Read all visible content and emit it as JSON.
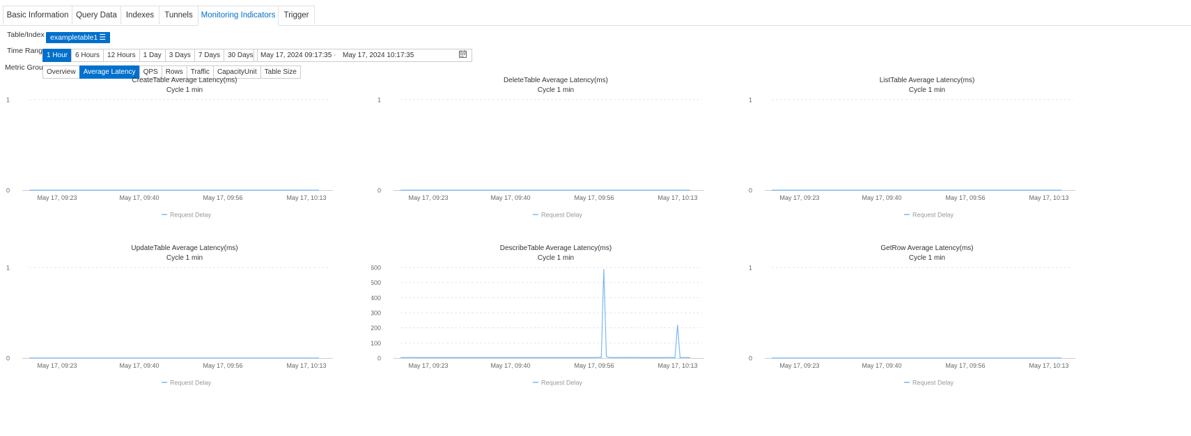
{
  "tabs": [
    "Basic Information",
    "Query Data",
    "Indexes",
    "Tunnels",
    "Monitoring Indicators",
    "Trigger"
  ],
  "active_tab": "Monitoring Indicators",
  "filters": {
    "table_label": "Table/Index",
    "table_value": "exampletable1",
    "time_label": "Time Range",
    "time_options": [
      "1 Hour",
      "6 Hours",
      "12 Hours",
      "1 Day",
      "3 Days",
      "7 Days",
      "30 Days"
    ],
    "time_selected": "1 Hour",
    "start": "May 17, 2024 09:17:35",
    "range_sep": "-",
    "end": "May 17, 2024 10:17:35",
    "metric_label": "Metric Group",
    "metric_options": [
      "Overview",
      "Average Latency",
      "QPS",
      "Rows",
      "Traffic",
      "CapacityUnit",
      "Table Size"
    ],
    "metric_selected": "Average Latency"
  },
  "colors": {
    "accent": "#0070cc",
    "series": "#7ab8f5"
  },
  "chart_data": [
    {
      "type": "line",
      "title": "CreateTable Average Latency(ms)",
      "subtitle": "Cycle 1 min",
      "x_ticks": [
        "May 17, 09:23",
        "May 17, 09:40",
        "May 17, 09:56",
        "May 17, 10:13"
      ],
      "y_ticks": [
        0,
        1
      ],
      "ylim": [
        0,
        1
      ],
      "series": [
        {
          "name": "Request Delay",
          "values": [
            0,
            0
          ]
        }
      ]
    },
    {
      "type": "line",
      "title": "DeleteTable Average Latency(ms)",
      "subtitle": "Cycle 1 min",
      "x_ticks": [
        "May 17, 09:23",
        "May 17, 09:40",
        "May 17, 09:56",
        "May 17, 10:13"
      ],
      "y_ticks": [
        0,
        1
      ],
      "ylim": [
        0,
        1
      ],
      "series": [
        {
          "name": "Request Delay",
          "values": [
            0,
            0
          ]
        }
      ]
    },
    {
      "type": "line",
      "title": "ListTable Average Latency(ms)",
      "subtitle": "Cycle 1 min",
      "x_ticks": [
        "May 17, 09:23",
        "May 17, 09:40",
        "May 17, 09:56",
        "May 17, 10:13"
      ],
      "y_ticks": [
        0,
        1
      ],
      "ylim": [
        0,
        1
      ],
      "series": [
        {
          "name": "Request Delay",
          "values": [
            0,
            0
          ]
        }
      ]
    },
    {
      "type": "line",
      "title": "UpdateTable Average Latency(ms)",
      "subtitle": "Cycle 1 min",
      "x_ticks": [
        "May 17, 09:23",
        "May 17, 09:40",
        "May 17, 09:56",
        "May 17, 10:13"
      ],
      "y_ticks": [
        0,
        1
      ],
      "ylim": [
        0,
        1
      ],
      "series": [
        {
          "name": "Request Delay",
          "values": [
            0,
            0
          ]
        }
      ]
    },
    {
      "type": "line",
      "title": "DescribeTable Average Latency(ms)",
      "subtitle": "Cycle 1 min",
      "x_ticks": [
        "May 17, 09:23",
        "May 17, 09:40",
        "May 17, 09:56",
        "May 17, 10:13"
      ],
      "y_ticks": [
        0,
        100,
        200,
        300,
        400,
        500,
        600
      ],
      "ylim": [
        0,
        600
      ],
      "series": [
        {
          "name": "Request Delay",
          "values": [
            3,
            3,
            3,
            3,
            4,
            3,
            3,
            3,
            3,
            3,
            3,
            3,
            3,
            3,
            3,
            3,
            3,
            3,
            3,
            3,
            3,
            3,
            3,
            3,
            3,
            3,
            3,
            3,
            3,
            3,
            3,
            3,
            3,
            3,
            3,
            3,
            3,
            3,
            3,
            3,
            3,
            3,
            3,
            3,
            3,
            3,
            3,
            3,
            3,
            3,
            3,
            3,
            3,
            3,
            3,
            3,
            3,
            3,
            3,
            3,
            3,
            3,
            3,
            3,
            3,
            3,
            3,
            3,
            3,
            3,
            3,
            3,
            3,
            3,
            3,
            3,
            3,
            3,
            4,
            4,
            590,
            10,
            4,
            3,
            3,
            3,
            3,
            3,
            4,
            3,
            4,
            3,
            3,
            4,
            3,
            3,
            3,
            3,
            3,
            3,
            3,
            3,
            3,
            3,
            3,
            4,
            3,
            3,
            3,
            220,
            3,
            3,
            3,
            3,
            3
          ]
        }
      ]
    },
    {
      "type": "line",
      "title": "GetRow Average Latency(ms)",
      "subtitle": "Cycle 1 min",
      "x_ticks": [
        "May 17, 09:23",
        "May 17, 09:40",
        "May 17, 09:56",
        "May 17, 10:13"
      ],
      "y_ticks": [
        0,
        1
      ],
      "ylim": [
        0,
        1
      ],
      "series": [
        {
          "name": "Request Delay",
          "values": [
            0,
            0
          ]
        }
      ]
    }
  ]
}
